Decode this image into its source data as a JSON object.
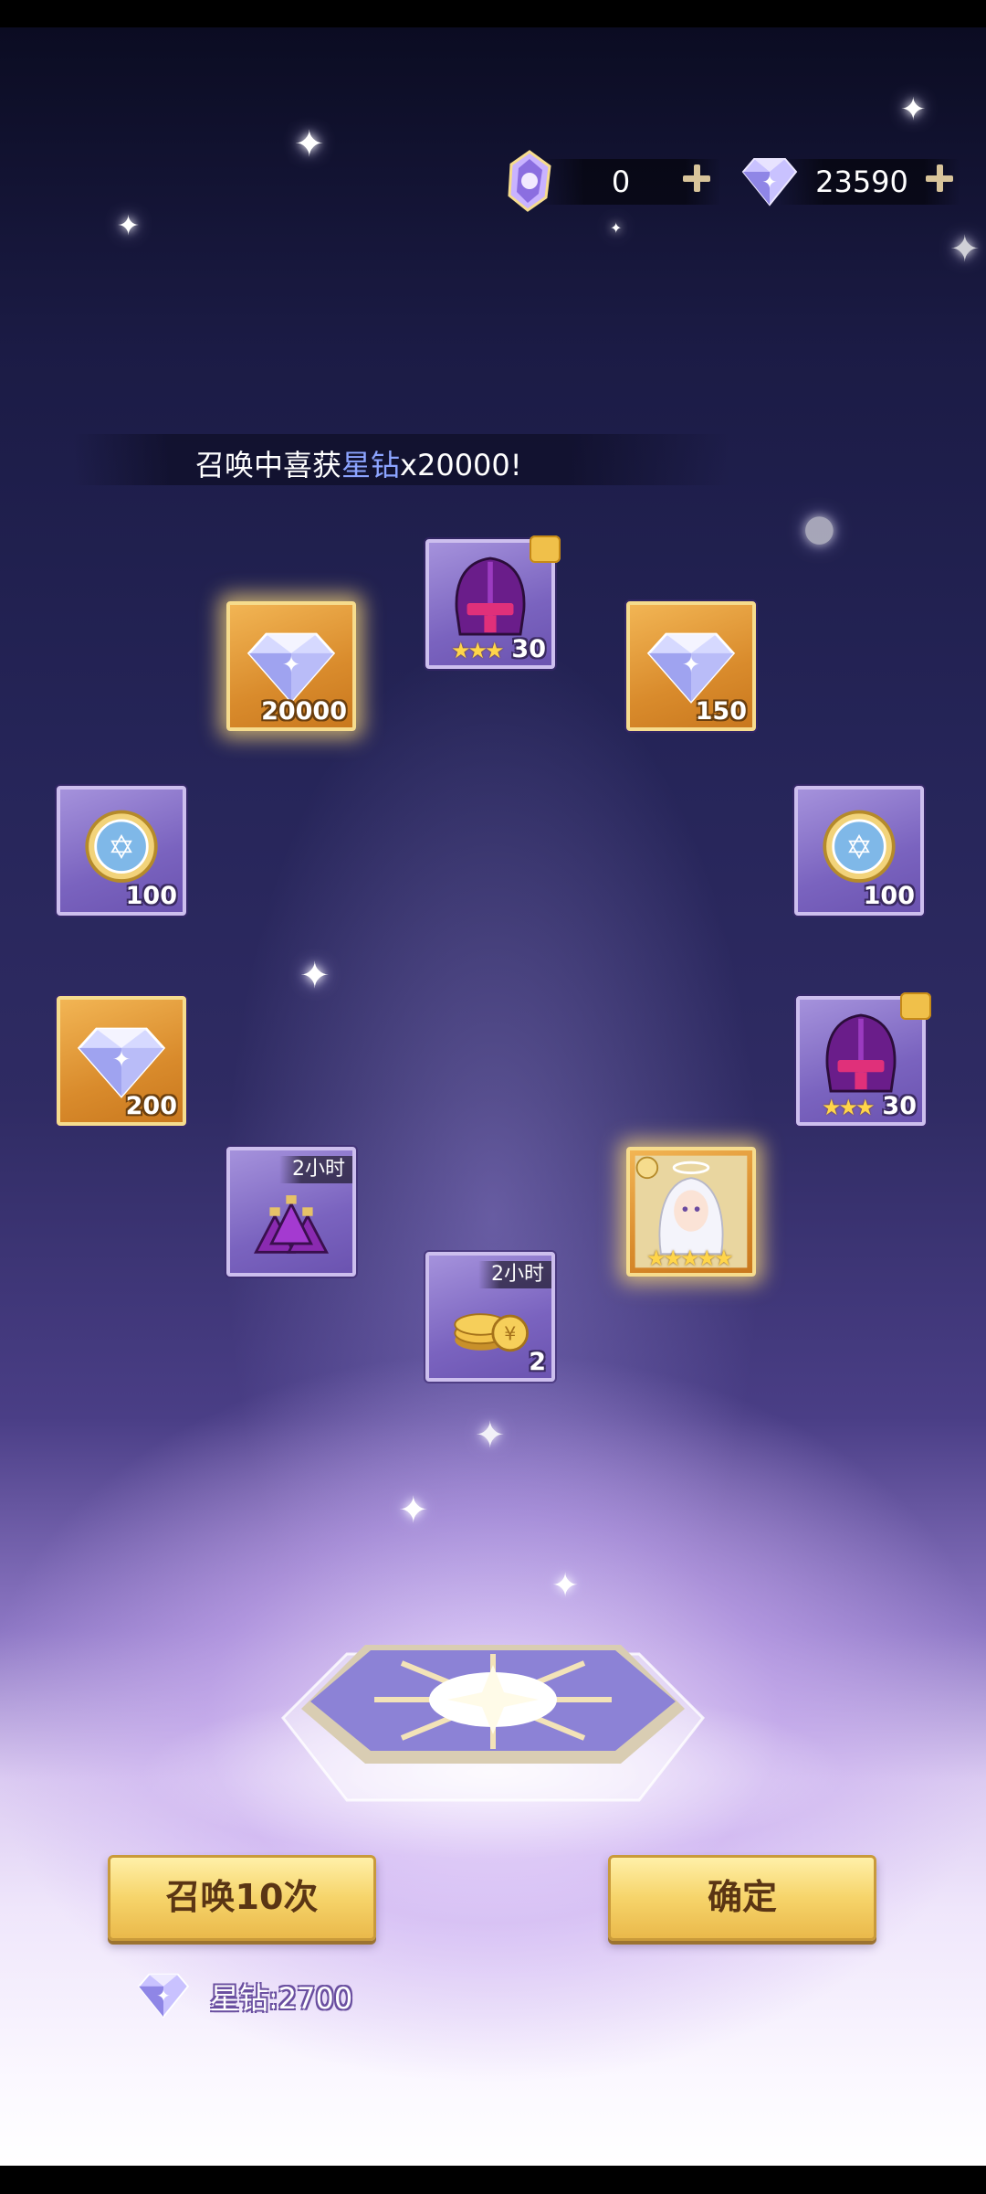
{
  "currency": {
    "summon_crystal": {
      "icon": "summon-crystal-icon",
      "value": "0"
    },
    "star_diamond": {
      "icon": "star-diamond-icon",
      "value": "23590"
    }
  },
  "announcement": {
    "prefix": "召唤中喜获",
    "highlight": "星钻",
    "suffix": "x20000!",
    "highlight_color": "#8ca4ff"
  },
  "rewards": [
    {
      "item": "star-diamond",
      "count": "20000",
      "frame": "gold"
    },
    {
      "item": "purple-helmet-shard",
      "count": "30",
      "frame": "purple",
      "stars": "★★★"
    },
    {
      "item": "star-diamond",
      "count": "150",
      "frame": "gold"
    },
    {
      "item": "summon-coin",
      "count": "100",
      "frame": "purple"
    },
    {
      "item": "summon-coin",
      "count": "100",
      "frame": "purple"
    },
    {
      "item": "star-diamond",
      "count": "200",
      "frame": "gold"
    },
    {
      "item": "purple-helmet-shard",
      "count": "30",
      "frame": "purple",
      "stars": "★★★"
    },
    {
      "item": "exp-potion-pack",
      "timer": "2小时",
      "frame": "purple"
    },
    {
      "item": "hero-white-hair-angel",
      "frame": "gold",
      "stars": "★★★★★"
    },
    {
      "item": "gold-coins",
      "count": "2",
      "timer": "2小时",
      "frame": "purple"
    }
  ],
  "actions": {
    "summon10_label": "召唤10次",
    "confirm_label": "确定",
    "cost_label": "星钻:2700"
  },
  "colors": {
    "button_gold": "#f6d46a",
    "button_text": "#5a3514",
    "card_purple": "#7a63bf",
    "card_gold": "#d98b2c"
  }
}
